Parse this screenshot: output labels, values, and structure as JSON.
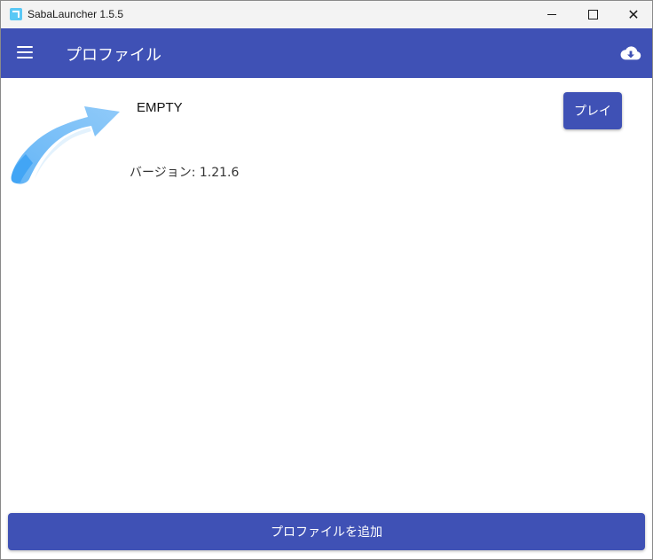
{
  "window": {
    "title": "SabaLauncher 1.5.5"
  },
  "appbar": {
    "title": "プロファイル",
    "background": "#3f51b5"
  },
  "icons": {
    "menu": "menu-icon",
    "download": "cloud-download-icon",
    "minimize": "minimize-icon",
    "maximize": "maximize-icon",
    "close": "close-icon"
  },
  "profile": {
    "name": "EMPTY",
    "version": "バージョン: 1.21.6",
    "play_label": "プレイ"
  },
  "footer": {
    "add_profile_label": "プロファイルを追加"
  }
}
